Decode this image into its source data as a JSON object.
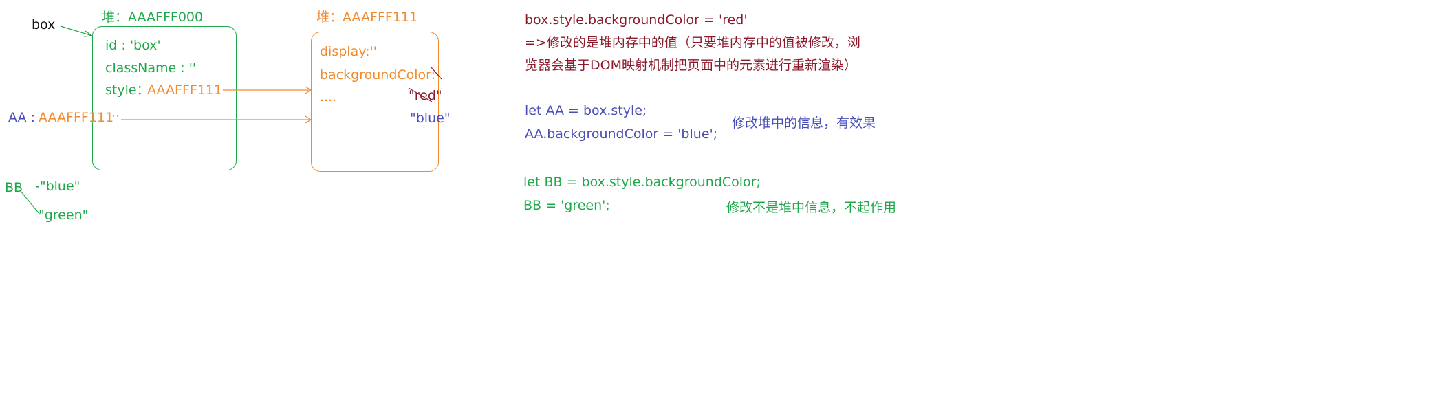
{
  "left": {
    "box_var": "box",
    "heap1_title": "堆：AAAFFF000",
    "heap1_props": {
      "id": "id : 'box'",
      "className": "className : ''",
      "style_key": "style：",
      "style_val": "AAAFFF111"
    },
    "heap2_title": "堆：AAAFFF111",
    "heap2_props": {
      "display": "display:''",
      "bg": "backgroundColor:",
      "more": "....",
      "red": "\"red\"",
      "blue": "\"blue\""
    },
    "aa_label": "AA :",
    "aa_value": "AAAFFF111",
    "aa_dots": "···",
    "bb_label": "BB",
    "bb_blue": "-\"blue\"",
    "bb_green": "\"green\""
  },
  "right": {
    "line1": "box.style.backgroundColor = 'red'",
    "line2": "=>修改的是堆内存中的值（只要堆内存中的值被修改，浏",
    "line3": "览器会基于DOM映射机制把页面中的元素进行重新渲染）",
    "aa_line1": "let AA = box.style;",
    "aa_line2": "AA.backgroundColor = 'blue';",
    "aa_note": "修改堆中的信息，有效果",
    "bb_line1": "let BB = box.style.backgroundColor;",
    "bb_line2": "BB = 'green';",
    "bb_note": "修改不是堆中信息，不起作用"
  },
  "colors": {
    "green": "#1ea84a",
    "orange": "#f28a2e",
    "maroon": "#8b1a2b",
    "blue": "#4a4fb8",
    "black": "#111111"
  }
}
